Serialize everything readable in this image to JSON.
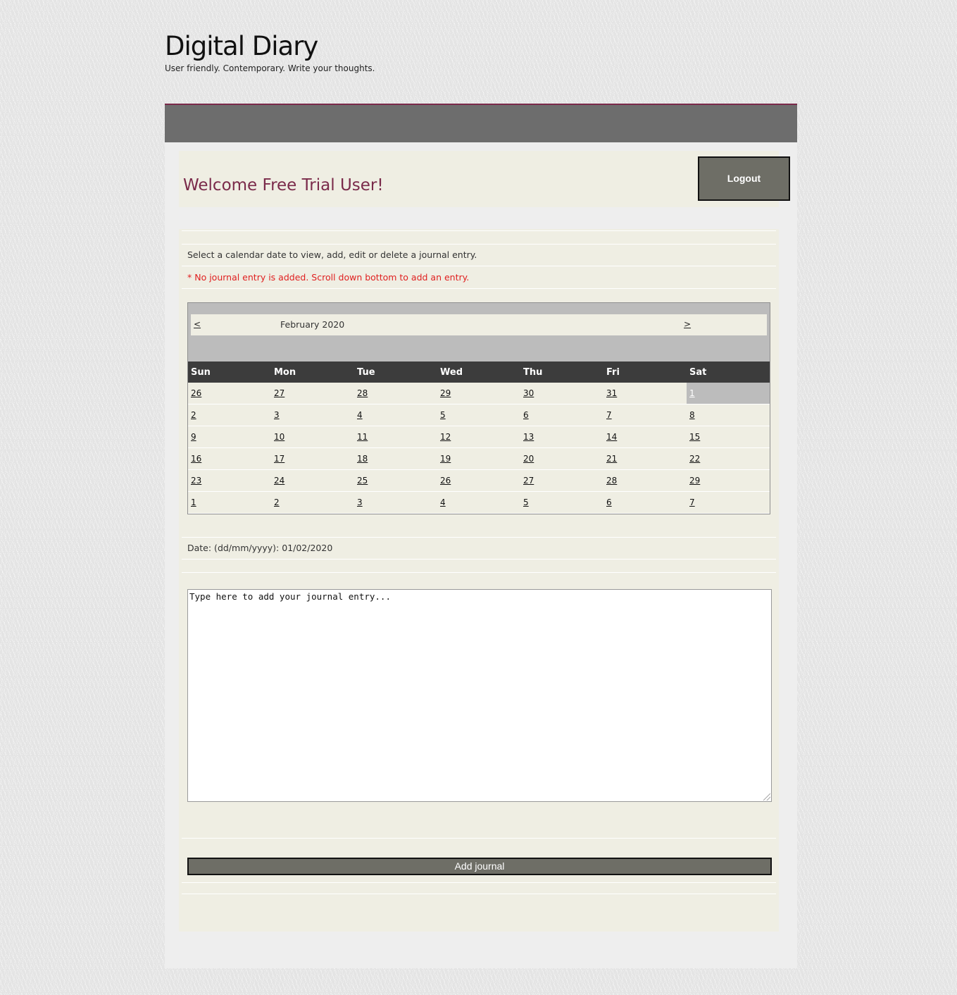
{
  "site": {
    "title": "Digital Diary",
    "tagline": "User friendly. Contemporary. Write your thoughts."
  },
  "welcome": {
    "message": "Welcome Free Trial User!",
    "logout_label": "Logout"
  },
  "instructions": {
    "select_text": "Select a calendar date to view, add, edit or delete a journal entry.",
    "warning_text": "* No journal entry is added. Scroll down bottom to add an entry."
  },
  "calendar": {
    "prev_label": "<",
    "next_label": ">",
    "month_label": "February 2020",
    "weekdays": [
      "Sun",
      "Mon",
      "Tue",
      "Wed",
      "Thu",
      "Fri",
      "Sat"
    ],
    "weeks": [
      [
        "26",
        "27",
        "28",
        "29",
        "30",
        "31",
        "1"
      ],
      [
        "2",
        "3",
        "4",
        "5",
        "6",
        "7",
        "8"
      ],
      [
        "9",
        "10",
        "11",
        "12",
        "13",
        "14",
        "15"
      ],
      [
        "16",
        "17",
        "18",
        "19",
        "20",
        "21",
        "22"
      ],
      [
        "23",
        "24",
        "25",
        "26",
        "27",
        "28",
        "29"
      ],
      [
        "1",
        "2",
        "3",
        "4",
        "5",
        "6",
        "7"
      ]
    ],
    "selected_day": "1"
  },
  "entry": {
    "date_label": "Date: (dd/mm/yyyy): 01/02/2020",
    "placeholder": "Type here to add your journal entry...",
    "value": "",
    "add_label": "Add journal"
  },
  "colors": {
    "accent": "#7a2a4a",
    "warning": "#e02020",
    "button_bg": "#6e6e66",
    "nav_bg": "#6d6d6d",
    "panel_bg": "#efeee3"
  }
}
